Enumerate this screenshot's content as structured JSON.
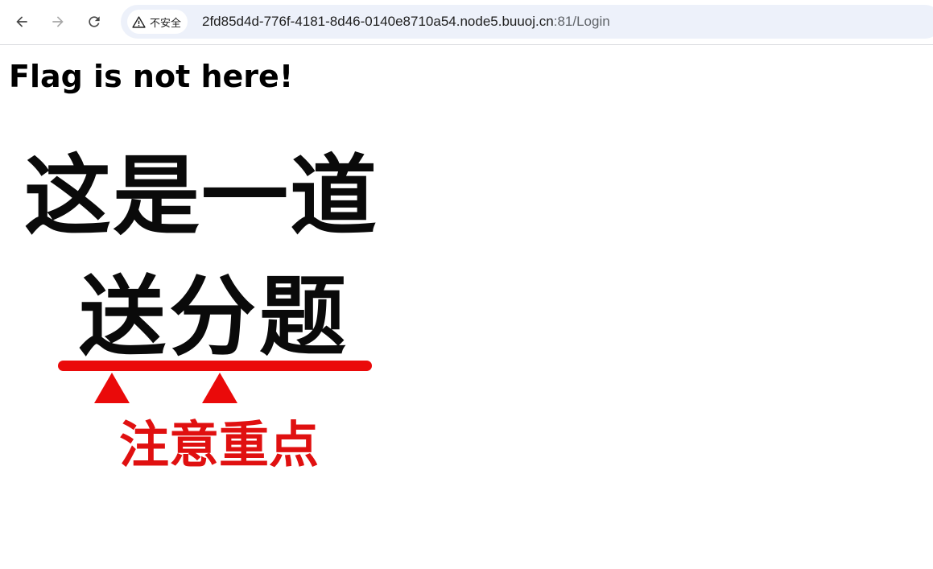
{
  "browser": {
    "security_label": "不安全",
    "url_host": "2fd85d4d-776f-4181-8d46-0140e8710a54.node5.buuoj.cn",
    "url_path": ":81/Login",
    "icons": [
      "back-icon",
      "forward-icon",
      "reload-icon",
      "warning-icon"
    ]
  },
  "page": {
    "heading": "Flag is not here!",
    "meme": {
      "line1": "这是一道",
      "line2": "送分题",
      "line3": "注意重点",
      "text_color": "#0a0a0a",
      "accent_color": "#ea0a0a"
    }
  }
}
